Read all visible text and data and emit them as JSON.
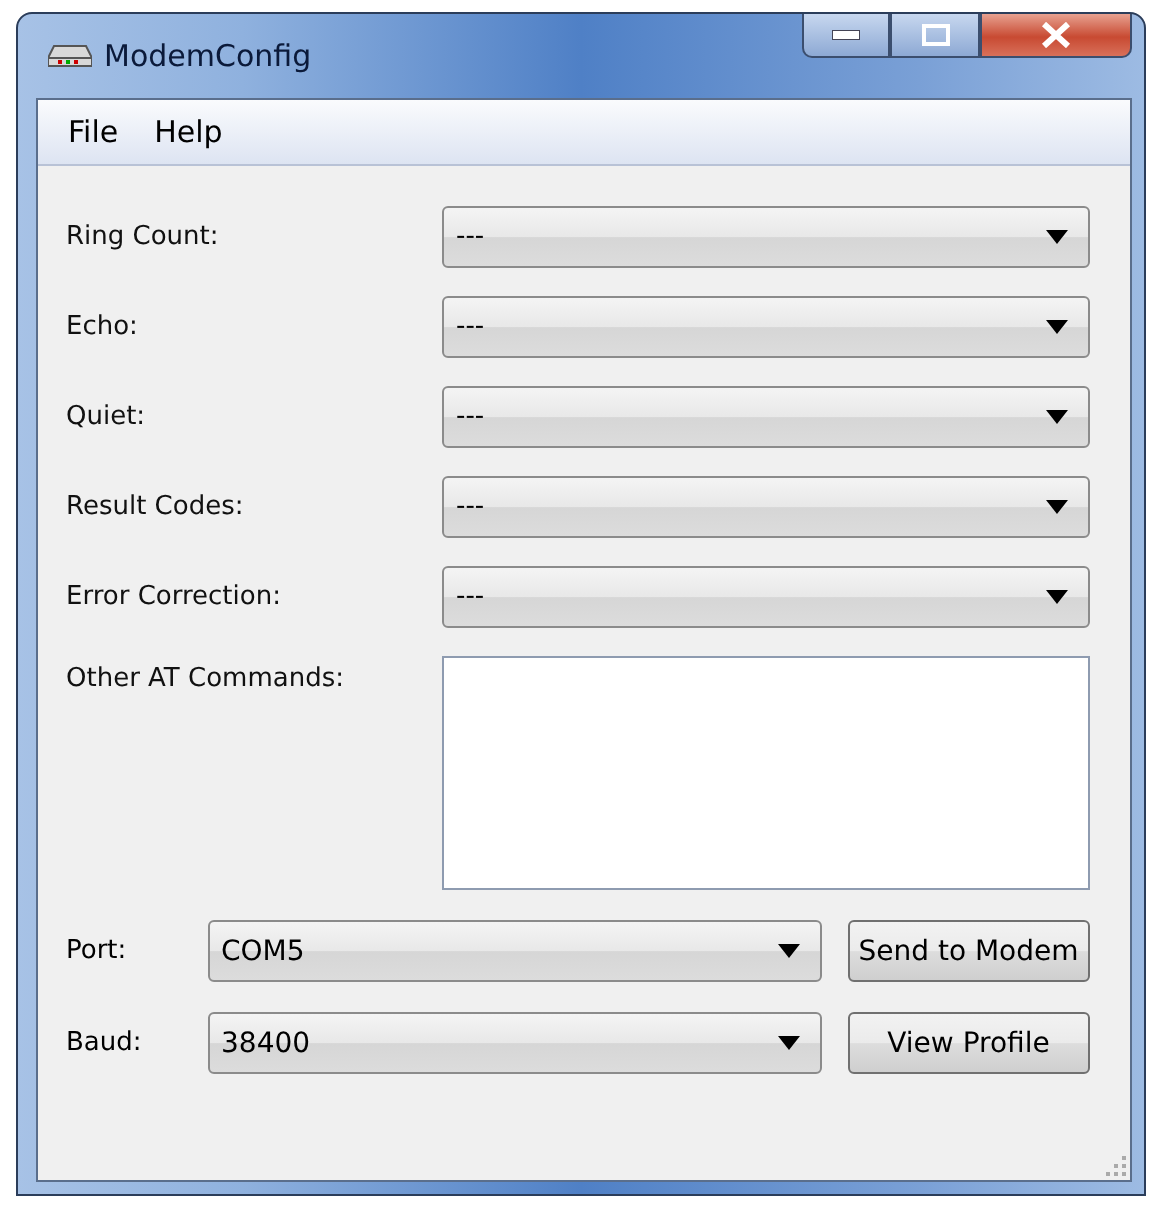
{
  "window": {
    "title": "ModemConfig"
  },
  "menu": [
    "File",
    "Help"
  ],
  "settings": [
    {
      "label": "Ring Count:",
      "value": "---"
    },
    {
      "label": "Echo:",
      "value": "---"
    },
    {
      "label": "Quiet:",
      "value": "---"
    },
    {
      "label": "Result Codes:",
      "value": "---"
    },
    {
      "label": "Error Correction:",
      "value": "---"
    }
  ],
  "other_commands": {
    "label": "Other AT Commands:"
  },
  "connection": [
    {
      "label": "Port:",
      "value": "COM5",
      "button": "Send to Modem"
    },
    {
      "label": "Baud:",
      "value": "38400",
      "button": "View Profile"
    }
  ]
}
